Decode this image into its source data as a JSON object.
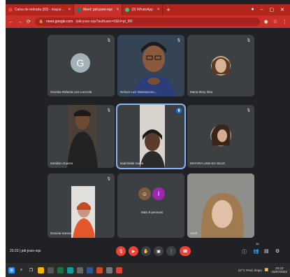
{
  "browser": {
    "tabs": [
      {
        "title": "Caixa de entrada (83) - mayar...",
        "active": false
      },
      {
        "title": "Meet: pdi-jcwo-xqs",
        "active": true
      },
      {
        "title": "(9) WhatsApp",
        "active": false
      }
    ],
    "url_host": "meet.google.com",
    "url_path": "/pdi-jcwo-xqs?authuser=0&hl=pt_BR"
  },
  "meet": {
    "participants": [
      {
        "name": "Grasika Rafaela Lins Lacerda",
        "type": "avatar",
        "initial": "G",
        "avatar_color": "#a3b1b9"
      },
      {
        "name": "Nelson Luiz Damasceno...",
        "type": "video"
      },
      {
        "name": "Maria Mary lima",
        "type": "photo"
      },
      {
        "name": "Genilton Guerra",
        "type": "video"
      },
      {
        "name": "kadchelde maria",
        "type": "video",
        "speaking": true
      },
      {
        "name": "MAYARA LIMA DA SILVA",
        "type": "photo"
      },
      {
        "name": "Daniela Santos",
        "type": "video"
      },
      {
        "name": "Mais 8 pessoas",
        "type": "group",
        "initial": "I",
        "avatar_color": "#9c27b0"
      },
      {
        "name": "Você",
        "type": "video"
      }
    ],
    "time": "20:23",
    "meeting_code": "pdi-jcwo-xqs",
    "participant_count": "18"
  },
  "taskbar": {
    "weather": "22°C  Pred. limpo",
    "time": "20:23",
    "date": "15/07/2022"
  },
  "colors": {
    "browser_red": "#c9302a",
    "meet_bg": "#202124",
    "tile_bg": "#3c4043",
    "end_call": "#ea4335",
    "speaking_blue": "#8ab4f8"
  }
}
